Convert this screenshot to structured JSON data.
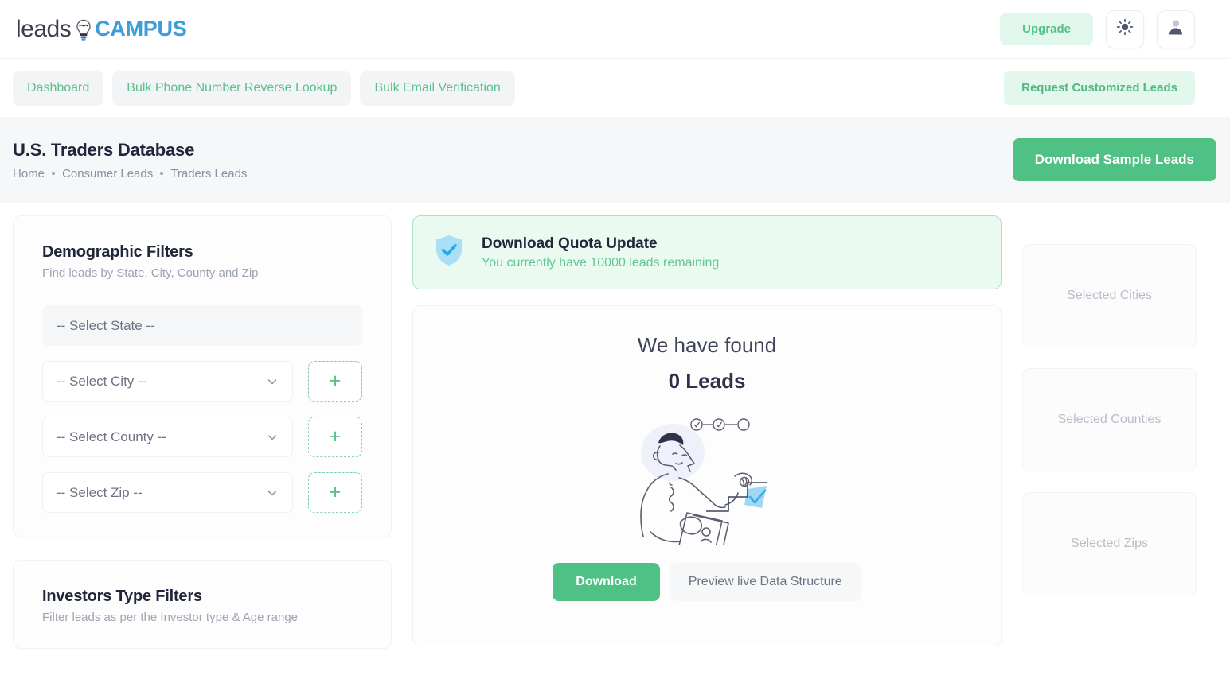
{
  "header": {
    "logo_leads": "leads",
    "logo_campus": "CAMPUS",
    "upgrade_label": "Upgrade",
    "theme_icon": "sun-icon",
    "account_icon": "user-avatar-icon"
  },
  "nav": {
    "items": [
      {
        "label": "Dashboard"
      },
      {
        "label": "Bulk Phone Number Reverse Lookup"
      },
      {
        "label": "Bulk Email Verification"
      }
    ],
    "request_label": "Request Customized Leads"
  },
  "page_header": {
    "title": "U.S. Traders Database",
    "breadcrumb": [
      "Home",
      "Consumer Leads",
      "Traders Leads"
    ],
    "download_sample_label": "Download Sample Leads"
  },
  "demographic_filters": {
    "title": "Demographic Filters",
    "subtitle": "Find leads by State, City, County and Zip",
    "state": {
      "value": "-- Select State --"
    },
    "city": {
      "value": "-- Select City --",
      "add_label": "+"
    },
    "county": {
      "value": "-- Select County --",
      "add_label": "+"
    },
    "zip": {
      "value": "-- Select Zip --",
      "add_label": "+"
    }
  },
  "investors_filters": {
    "title": "Investors Type Filters",
    "subtitle": "Filter leads as per the Investor type & Age range"
  },
  "quota": {
    "title": "Download Quota Update",
    "subtitle": "You currently have 10000 leads remaining",
    "icon": "shield-check-icon"
  },
  "results": {
    "found_label": "We have found",
    "count_label": "0 Leads",
    "download_label": "Download",
    "preview_label": "Preview live Data Structure",
    "illustration": "person-with-document-illustration"
  },
  "selections": {
    "cities_placeholder": "Selected Cities",
    "counties_placeholder": "Selected Counties",
    "zips_placeholder": "Selected Zips"
  },
  "colors": {
    "accent_green": "#4fc184",
    "accent_green_soft": "#e2f7ec",
    "brand_blue": "#3c9ddb",
    "text_dark": "#22263a",
    "text_muted": "#9ea3b3"
  }
}
